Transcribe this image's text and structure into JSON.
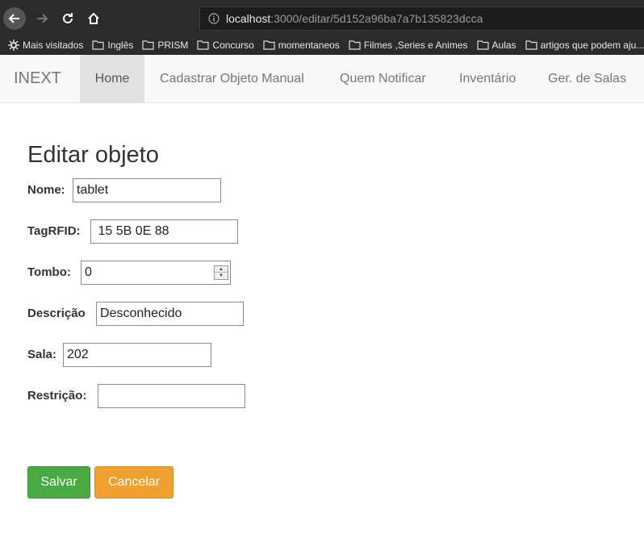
{
  "browser": {
    "url_host": "localhost",
    "url_path": ":3000/editar/5d152a96ba7a7b135823dcca",
    "bookmarks": [
      {
        "label": "Mais visitados",
        "icon": "gear-icon"
      },
      {
        "label": "Inglês",
        "icon": "folder-icon"
      },
      {
        "label": "PRISM",
        "icon": "folder-icon"
      },
      {
        "label": "Concurso",
        "icon": "folder-icon"
      },
      {
        "label": "momentaneos",
        "icon": "folder-icon"
      },
      {
        "label": "Filmes ,Series e Animes",
        "icon": "folder-icon"
      },
      {
        "label": "Aulas",
        "icon": "folder-icon"
      },
      {
        "label": "artigos que podem aju...",
        "icon": "folder-icon"
      }
    ]
  },
  "navbar": {
    "brand": "INEXT",
    "items": [
      "Home",
      "Cadastrar Objeto Manual",
      "Quem Notificar",
      "Inventário",
      "Ger. de Salas"
    ]
  },
  "form": {
    "title": "Editar objeto",
    "fields": [
      {
        "label": "Nome:",
        "value": "tablet"
      },
      {
        "label": "TagRFID:",
        "value": " 15 5B 0E 88"
      },
      {
        "label": "Tombo:",
        "value": "0"
      },
      {
        "label": "Descrição",
        "value": "Desconhecido"
      },
      {
        "label": "Sala:",
        "value": "202"
      },
      {
        "label": "Restrição:",
        "value": ""
      }
    ],
    "save_label": "Salvar",
    "cancel_label": "Cancelar"
  },
  "colors": {
    "save": "#49a942",
    "cancel": "#f0a030",
    "chrome": "#2b2b2b"
  }
}
